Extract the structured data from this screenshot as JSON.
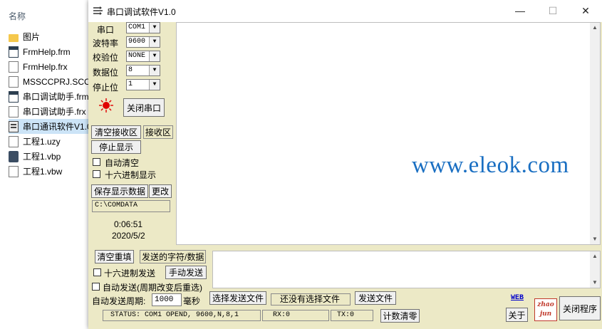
{
  "explorer": {
    "header": "名称",
    "items": [
      {
        "name": "图片",
        "icon": "folder-icon"
      },
      {
        "name": "FrmHelp.frm",
        "icon": "form-file-icon"
      },
      {
        "name": "FrmHelp.frx",
        "icon": "file-icon"
      },
      {
        "name": "MSSCCPRJ.SCC",
        "icon": "file-icon"
      },
      {
        "name": "串口调试助手.frm",
        "icon": "form-file-icon"
      },
      {
        "name": "串口调试助手.frx",
        "icon": "file-icon"
      },
      {
        "name": "串口通讯软件V1.0",
        "icon": "exe-icon"
      },
      {
        "name": "工程1.uzy",
        "icon": "file-icon"
      },
      {
        "name": "工程1.vbp",
        "icon": "vb-project-icon"
      },
      {
        "name": "工程1.vbw",
        "icon": "file-icon"
      }
    ]
  },
  "window": {
    "title": "串口调试软件V1.0",
    "minimize": "—",
    "maximize": "☐",
    "close": "✕"
  },
  "settings": {
    "port_label": "串口",
    "port_value": "COM1",
    "baud_label": "波特率",
    "baud_value": "9600",
    "parity_label": "校验位",
    "parity_value": "NONE",
    "databits_label": "数据位",
    "databits_value": "8",
    "stopbits_label": "停止位",
    "stopbits_value": "1",
    "close_port_button": "关闭串口"
  },
  "receive": {
    "clear_button": "清空接收区",
    "area_label": "接收区",
    "stop_display_button": "停止显示",
    "auto_clear_label": "自动清空",
    "hex_display_label": "十六进制显示",
    "save_button": "保存显示数据",
    "change_button": "更改",
    "save_path": "C:\\COMDATA",
    "time": "0:06:51",
    "date": "2020/5/2"
  },
  "send": {
    "clear_button": "清空重填",
    "area_label": "发送的字符/数据",
    "hex_send_label": "十六进制发送",
    "manual_send_button": "手动发送",
    "auto_send_label": "自动发送(周期改变后重选)",
    "period_label": "自动发送周期:",
    "period_value": "1000",
    "period_unit": "毫秒",
    "choose_file_button": "选择发送文件",
    "file_status": "还没有选择文件",
    "send_file_button": "发送文件"
  },
  "status": {
    "status_text": "STATUS: COM1 OPEND, 9600,N,8,1",
    "rx": "RX:0",
    "tx": "TX:0",
    "reset_count_button": "计数清零"
  },
  "footer": {
    "web_link": "WEB",
    "about_button": "关于",
    "logo_text": "zhao jun",
    "close_program_button": "关闭程序"
  },
  "watermark": "www.eleok.com",
  "colors": {
    "panel_bg": "#ece9c6",
    "watermark": "#1a6fc2",
    "led": "#e00000",
    "web_link": "#0000cc",
    "logo": "#c0392b"
  }
}
